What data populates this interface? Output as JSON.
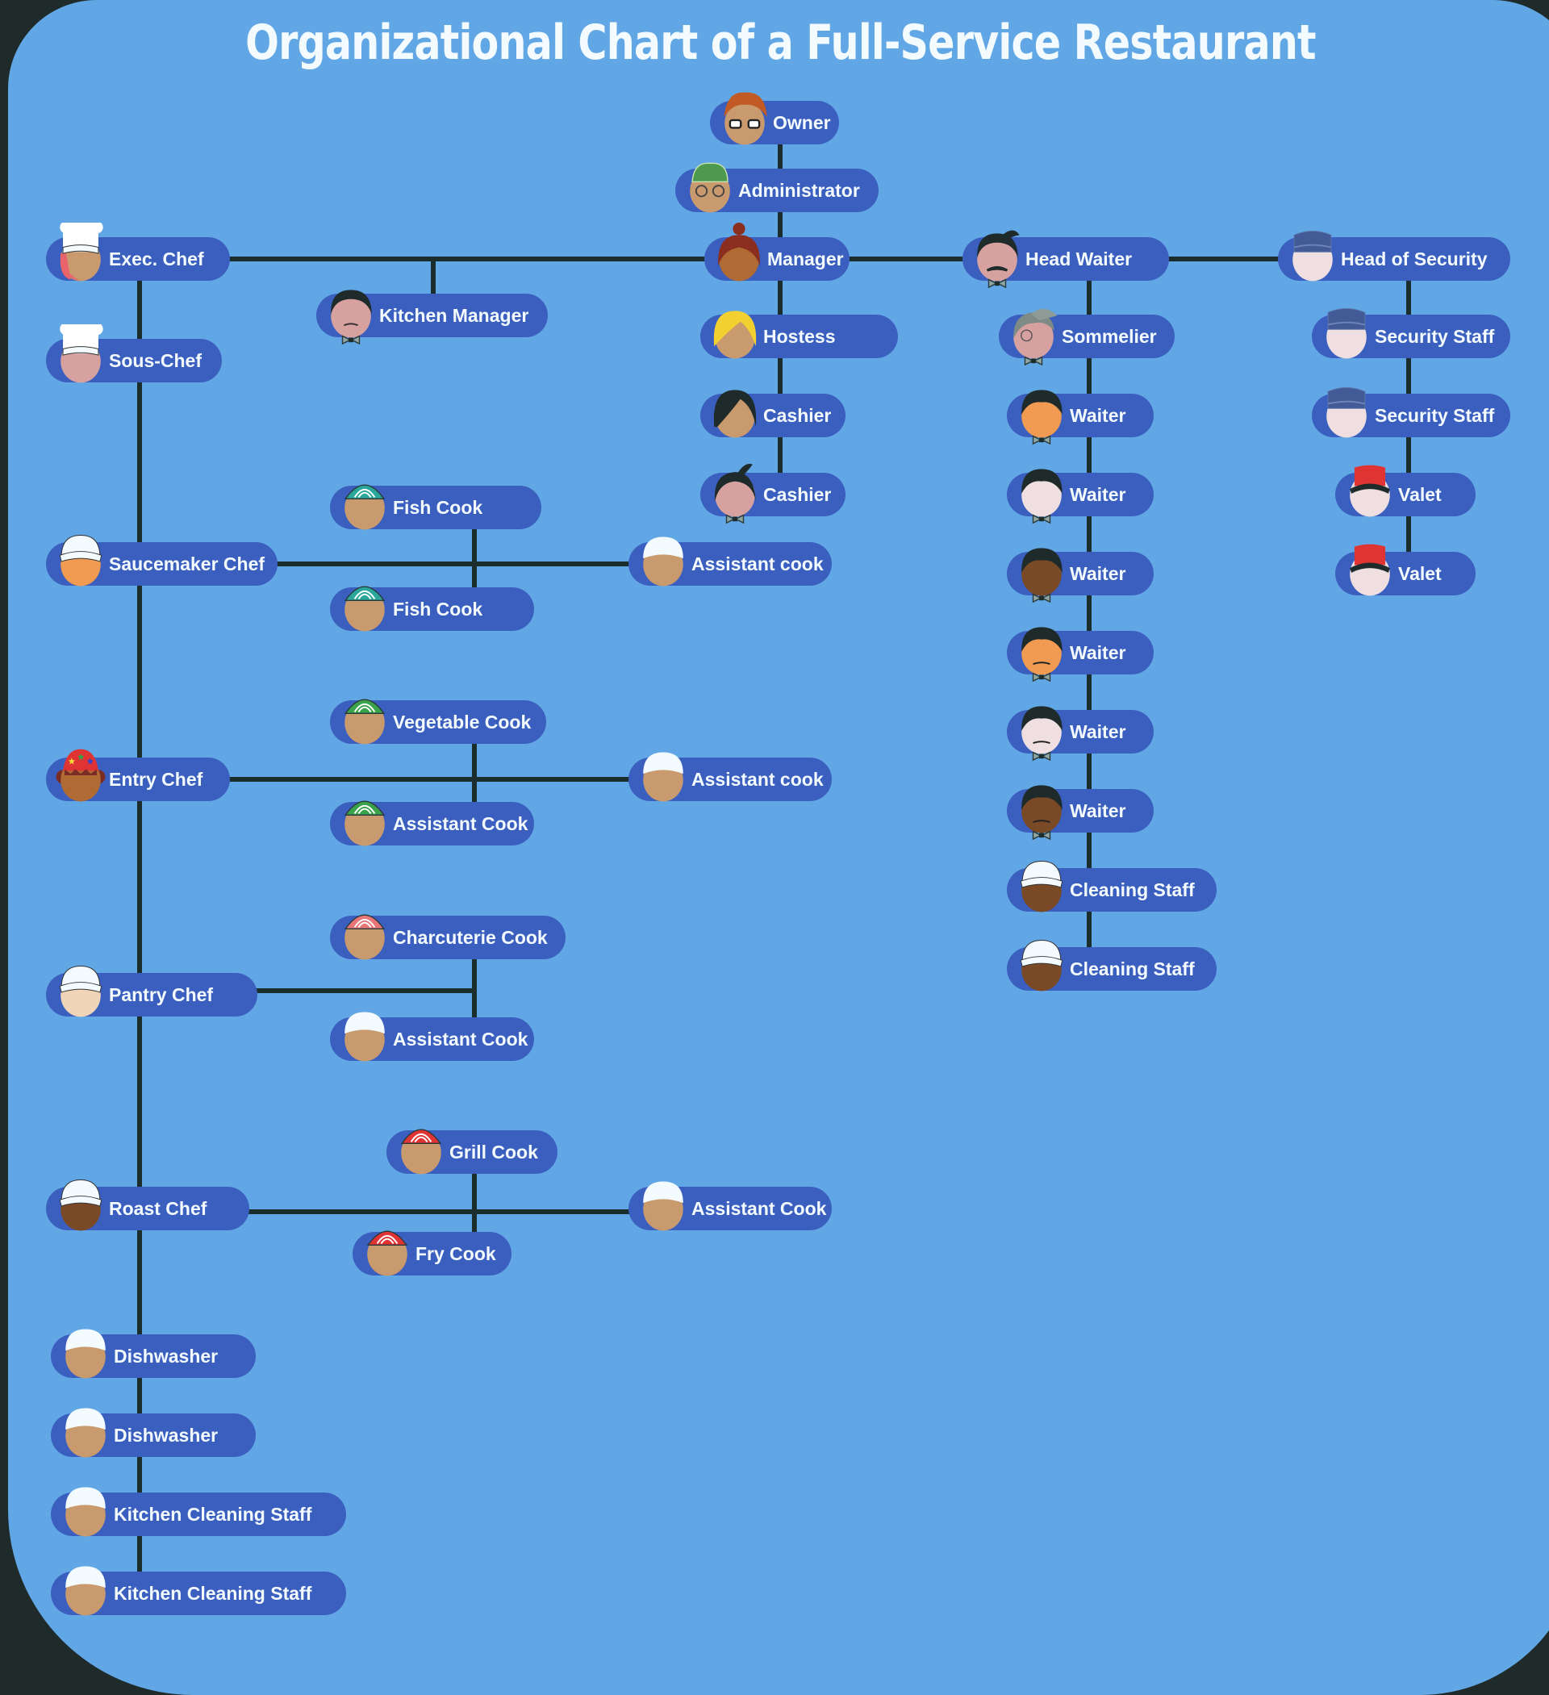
{
  "title": "Organizational Chart of a Full-Service Restaurant",
  "colors": {
    "background": "#62a7e5",
    "frame": "#1f2b2b",
    "node_fill": "#3b5fbf",
    "node_text": "#f4fbff",
    "connector": "#1c2d2d"
  },
  "nodes": [
    {
      "id": "owner",
      "label": "Owner",
      "parent": null,
      "avatar": "owner-glasses-redhair"
    },
    {
      "id": "administrator",
      "label": "Administrator",
      "parent": "owner",
      "avatar": "green-cap-glasses"
    },
    {
      "id": "manager",
      "label": "Manager",
      "parent": "administrator",
      "avatar": "hair-bun"
    },
    {
      "id": "hostess",
      "label": "Hostess",
      "parent": "manager",
      "avatar": "blonde-hair"
    },
    {
      "id": "cashier1",
      "label": "Cashier",
      "parent": "manager",
      "avatar": "dark-bob-hair"
    },
    {
      "id": "cashier2",
      "label": "Cashier",
      "parent": "manager",
      "avatar": "quiff-bowtie"
    },
    {
      "id": "exec_chef",
      "label": "Exec. Chef",
      "parent": "manager",
      "avatar": "chef-toque"
    },
    {
      "id": "kitchen_manager",
      "label": "Kitchen Manager",
      "parent": "exec_chef",
      "avatar": "mustache-bowtie"
    },
    {
      "id": "sous_chef",
      "label": "Sous-Chef",
      "parent": "exec_chef",
      "avatar": "chef-toque"
    },
    {
      "id": "saucemaker_chef",
      "label": "Saucemaker Chef",
      "parent": "sous_chef",
      "avatar": "white-cap"
    },
    {
      "id": "fish_cook1",
      "label": "Fish Cook",
      "parent": "saucemaker_chef",
      "avatar": "teal-hairnet"
    },
    {
      "id": "fish_cook2",
      "label": "Fish Cook",
      "parent": "saucemaker_chef",
      "avatar": "teal-hairnet"
    },
    {
      "id": "assistant_cook1",
      "label": "Assistant cook",
      "parent": "saucemaker_chef",
      "avatar": "white-skullcap"
    },
    {
      "id": "entry_chef",
      "label": "Entry Chef",
      "parent": "sous_chef",
      "avatar": "star-bandana"
    },
    {
      "id": "vegetable_cook",
      "label": "Vegetable Cook",
      "parent": "entry_chef",
      "avatar": "green-hairnet"
    },
    {
      "id": "assistant_cook2",
      "label": "Assistant Cook",
      "parent": "entry_chef",
      "avatar": "green-hairnet"
    },
    {
      "id": "assistant_cook3",
      "label": "Assistant cook",
      "parent": "entry_chef",
      "avatar": "white-skullcap"
    },
    {
      "id": "pantry_chef",
      "label": "Pantry Chef",
      "parent": "sous_chef",
      "avatar": "white-cap"
    },
    {
      "id": "charcuterie_cook",
      "label": "Charcuterie Cook",
      "parent": "pantry_chef",
      "avatar": "pink-hairnet"
    },
    {
      "id": "assistant_cook4",
      "label": "Assistant Cook",
      "parent": "pantry_chef",
      "avatar": "white-skullcap"
    },
    {
      "id": "roast_chef",
      "label": "Roast Chef",
      "parent": "sous_chef",
      "avatar": "white-cap"
    },
    {
      "id": "grill_cook",
      "label": "Grill Cook",
      "parent": "roast_chef",
      "avatar": "red-hairnet"
    },
    {
      "id": "fry_cook",
      "label": "Fry Cook",
      "parent": "roast_chef",
      "avatar": "red-hairnet"
    },
    {
      "id": "assistant_cook5",
      "label": "Assistant Cook",
      "parent": "roast_chef",
      "avatar": "white-skullcap"
    },
    {
      "id": "dishwasher1",
      "label": "Dishwasher",
      "parent": "sous_chef",
      "avatar": "white-skullcap"
    },
    {
      "id": "dishwasher2",
      "label": "Dishwasher",
      "parent": "sous_chef",
      "avatar": "white-skullcap"
    },
    {
      "id": "kitchen_cleaning1",
      "label": "Kitchen Cleaning Staff",
      "parent": "sous_chef",
      "avatar": "white-skullcap"
    },
    {
      "id": "kitchen_cleaning2",
      "label": "Kitchen Cleaning Staff",
      "parent": "sous_chef",
      "avatar": "white-skullcap"
    },
    {
      "id": "head_waiter",
      "label": "Head Waiter",
      "parent": "manager",
      "avatar": "mustache-bowtie-quiff"
    },
    {
      "id": "sommelier",
      "label": "Sommelier",
      "parent": "head_waiter",
      "avatar": "gray-hair-monocle"
    },
    {
      "id": "waiter1",
      "label": "Waiter",
      "parent": "head_waiter",
      "avatar": "waiter-bowtie"
    },
    {
      "id": "waiter2",
      "label": "Waiter",
      "parent": "head_waiter",
      "avatar": "waiter-bowtie"
    },
    {
      "id": "waiter3",
      "label": "Waiter",
      "parent": "head_waiter",
      "avatar": "waiter-bowtie"
    },
    {
      "id": "waiter4",
      "label": "Waiter",
      "parent": "head_waiter",
      "avatar": "waiter-bowtie-mustache"
    },
    {
      "id": "waiter5",
      "label": "Waiter",
      "parent": "head_waiter",
      "avatar": "waiter-bowtie-mustache"
    },
    {
      "id": "waiter6",
      "label": "Waiter",
      "parent": "head_waiter",
      "avatar": "waiter-bowtie-mustache"
    },
    {
      "id": "cleaning_staff1",
      "label": "Cleaning Staff",
      "parent": "head_waiter",
      "avatar": "white-cap"
    },
    {
      "id": "cleaning_staff2",
      "label": "Cleaning Staff",
      "parent": "head_waiter",
      "avatar": "white-cap"
    },
    {
      "id": "head_security",
      "label": "Head of Security",
      "parent": "manager",
      "avatar": "security-cap"
    },
    {
      "id": "security_staff1",
      "label": "Security Staff",
      "parent": "head_security",
      "avatar": "security-cap"
    },
    {
      "id": "security_staff2",
      "label": "Security Staff",
      "parent": "head_security",
      "avatar": "security-cap"
    },
    {
      "id": "valet1",
      "label": "Valet",
      "parent": "head_security",
      "avatar": "red-valet-cap"
    },
    {
      "id": "valet2",
      "label": "Valet",
      "parent": "head_security",
      "avatar": "red-valet-cap"
    }
  ]
}
